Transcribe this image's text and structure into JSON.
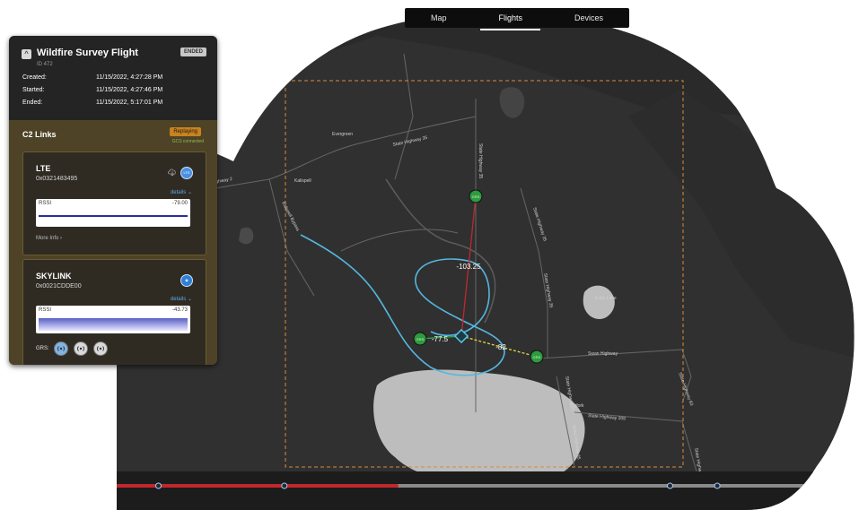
{
  "nav": {
    "tabs": [
      {
        "label": "Map"
      },
      {
        "label": "Flights",
        "active": true
      },
      {
        "label": "Devices"
      }
    ]
  },
  "flight": {
    "title": "Wildfire Survey Flight",
    "id": "ID 472",
    "status": "ENDED",
    "created_label": "Created:",
    "created_value": "11/15/2022, 4:27:28 PM",
    "started_label": "Started:",
    "started_value": "11/15/2022, 4:27:46 PM",
    "ended_label": "Ended:",
    "ended_value": "11/15/2022, 5:17:01 PM"
  },
  "c2": {
    "title": "C2 Links",
    "replay_badge": "Replaying",
    "gcs_status": "GCS connected",
    "links": [
      {
        "name": "LTE",
        "id": "0x0321483495",
        "details_label": "details",
        "rssi_label": "RSSI",
        "rssi_value": "-79.00",
        "more_info": "More Info",
        "icon": "lte-icon",
        "icon_text": "LTE"
      },
      {
        "name": "SKYLINK",
        "id": "0x0021CDDE00",
        "details_label": "details",
        "rssi_label": "RSSI",
        "rssi_value": "-43.73",
        "grs_label": "GRS:",
        "icon": "skylink-icon"
      }
    ]
  },
  "map": {
    "places": {
      "evergreen": "Evergreen",
      "kalispell": "Kalispell",
      "state_hwy_35_a": "State Highway 35",
      "state_hwy_35_b": "State Highway 35",
      "state_hwy_35_c": "State Highway 35",
      "state_hwy_35_d": "State Highway 35",
      "state_hwy_35_e": "State Highway 35",
      "state_hwy_35_f": "State Highway 35",
      "state_hwy_35_g": "State Highway 35",
      "kalispell_bypass": "Kalispell Bypass",
      "swan_highway": "Swan Highway",
      "bigfork": "Bigfork",
      "state_hwy_209": "State Highway 209",
      "echo_lake": "Echo Lake",
      "hwy_2": "Highway 2",
      "hwy_83": "State Highway 83"
    },
    "link_labels": {
      "top": "-103.25",
      "left": "-77.5",
      "right": "-82"
    },
    "station_icon_label": "GRS",
    "colors": {
      "flight_path": "#55b7df",
      "top_link": "#c0282c",
      "left_link": "#2fa84f",
      "right_link": "#e2d94a",
      "station_fill": "#2e9b3e",
      "drone_marker": "#56c7e8",
      "geofence": "#d98a3c"
    }
  },
  "playback": {
    "progress": 0.415,
    "markers": [
      0.0,
      0.11,
      0.27,
      0.76,
      0.82
    ]
  }
}
